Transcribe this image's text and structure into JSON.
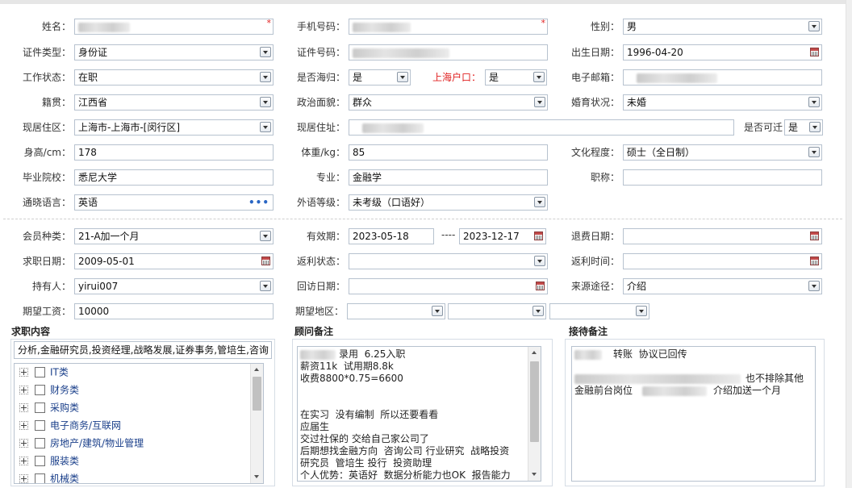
{
  "form": {
    "name": {
      "label": "姓名：",
      "value": ""
    },
    "phone": {
      "label": "手机号码：",
      "value": ""
    },
    "gender": {
      "label": "性别：",
      "value": "男"
    },
    "id_type": {
      "label": "证件类型：",
      "value": "身份证"
    },
    "id_number": {
      "label": "证件号码：",
      "value": ""
    },
    "birth_date": {
      "label": "出生日期：",
      "value": "1996-04-20"
    },
    "work_status": {
      "label": "工作状态：",
      "value": "在职"
    },
    "returnee": {
      "label": "是否海归：",
      "value": "是"
    },
    "shanghai_hukou": {
      "label": "上海户口：",
      "value": "是"
    },
    "email": {
      "label": "电子邮箱：",
      "value": ""
    },
    "native_place": {
      "label": "籍贯：",
      "value": "江西省"
    },
    "political_status": {
      "label": "政治面貌：",
      "value": "群众"
    },
    "marital_status": {
      "label": "婚育状况：",
      "value": "未婚"
    },
    "residence_area": {
      "label": "现居住区：",
      "value": "上海市-上海市-[闵行区]"
    },
    "address": {
      "label": "现居住址：",
      "value": ""
    },
    "relocatable": {
      "label": "是否可迁",
      "value": "是"
    },
    "height": {
      "label": "身高/cm：",
      "value": "178"
    },
    "weight": {
      "label": "体重/kg：",
      "value": "85"
    },
    "education": {
      "label": "文化程度：",
      "value": "硕士（全日制）"
    },
    "school": {
      "label": "毕业院校：",
      "value": "悉尼大学"
    },
    "major": {
      "label": "专业：",
      "value": "金融学"
    },
    "job_title": {
      "label": "职称：",
      "value": ""
    },
    "language": {
      "label": "通晓语言：",
      "value": "英语"
    },
    "language_level": {
      "label": "外语等级：",
      "value": "未考级（口语好）"
    },
    "member_type": {
      "label": "会员种类：",
      "value": "21-A加一个月"
    },
    "validity": {
      "label": "有效期：",
      "start": "2023-05-18",
      "separator": "----",
      "end": "2023-12-17"
    },
    "refund_date": {
      "label": "退费日期：",
      "value": ""
    },
    "job_search_date": {
      "label": "求职日期：",
      "value": "2009-05-01"
    },
    "rebate_status": {
      "label": "返利状态：",
      "value": ""
    },
    "rebate_time": {
      "label": "返利时间：",
      "value": ""
    },
    "holder": {
      "label": "持有人：",
      "value": "yirui007"
    },
    "return_visit_date": {
      "label": "回访日期：",
      "value": ""
    },
    "source": {
      "label": "来源途径：",
      "value": "介绍"
    },
    "expected_salary": {
      "label": "期望工资：",
      "value": "10000"
    },
    "expected_area": {
      "label": "期望地区：",
      "values": [
        "",
        "",
        ""
      ]
    }
  },
  "job_content": {
    "title": "求职内容",
    "summary": "分析,金融研究员,投资经理,战略发展,证券事务,管培生,咨询",
    "tree": [
      "IT类",
      "财务类",
      "采购类",
      "电子商务/互联网",
      "房地产/建筑/物业管理",
      "服装类",
      "机械类"
    ]
  },
  "advisor_notes": {
    "title": "顾问备注",
    "lines": [
      "录用  6.25入职",
      "薪资11k  试用期8.8k",
      "收费8800*0.75=6600",
      "",
      "",
      "在实习  没有编制  所以还要看看",
      "应届生",
      "交过社保的 交给自己家公司了",
      "后期想找金融方向  咨询公司 行业研究  战略投资",
      "研究员  管培生 投行  投资助理",
      "个人优势：英语好  数据分析能力也OK  报告能力"
    ]
  },
  "reception_notes": {
    "title": "接待备注",
    "lines": [
      "转账  协议已回传",
      "",
      "也不排除其他",
      "金融前台岗位",
      "介绍加送一个月"
    ]
  },
  "icons": {
    "dropdown": "chevron-down-icon",
    "calendar": "calendar-icon",
    "more": "more-dots-icon",
    "expand": "tree-expand-icon"
  },
  "colors": {
    "required_mark": "#e02020",
    "red_label": "#e02020",
    "border": "#b7c2cf",
    "tree_label": "#1a3f8a"
  }
}
